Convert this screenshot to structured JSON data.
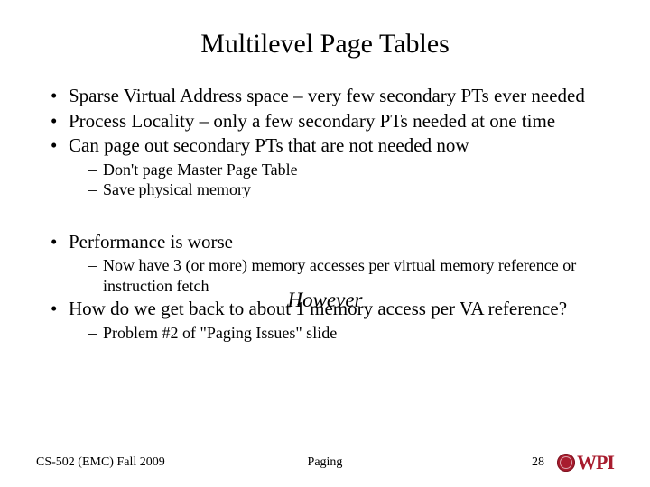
{
  "title": "Multilevel Page Tables",
  "b1": "Sparse Virtual Address space – very few secondary PTs ever needed",
  "b2": "Process Locality – only a few secondary PTs needed at one time",
  "b3": "Can page out secondary PTs that are not needed now",
  "b3s1": "Don't page Master Page Table",
  "b3s2": "Save physical memory",
  "however": "However",
  "b4": "Performance is worse",
  "b4s1": "Now have 3 (or more) memory accesses per virtual memory reference or instruction fetch",
  "b5": "How do we get back to about 1 memory access per VA reference?",
  "b5s1": "Problem #2 of \"Paging Issues\" slide",
  "footer": {
    "course": "CS-502 (EMC) Fall 2009",
    "topic": "Paging",
    "page": "28",
    "logo": "WPI"
  }
}
